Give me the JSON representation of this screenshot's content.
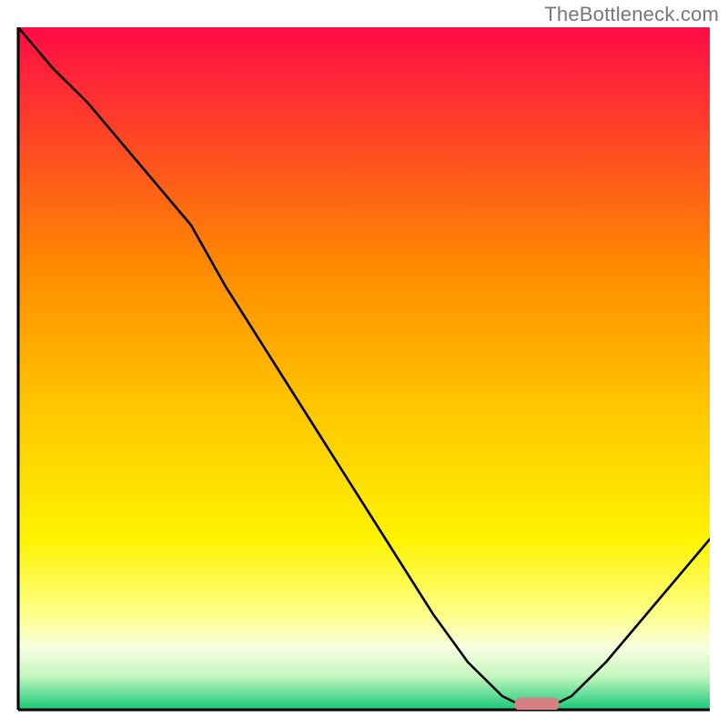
{
  "watermark": "TheBottleneck.com",
  "chart_data": {
    "type": "line",
    "title": "",
    "xlabel": "",
    "ylabel": "",
    "xlim": [
      0,
      100
    ],
    "ylim": [
      0,
      100
    ],
    "background_gradient": {
      "top": "#ff0b46",
      "upper_mid": "#ffa300",
      "lower_mid": "#fef300",
      "band": "#f5ffe2",
      "bottom": "#16c978"
    },
    "series": [
      {
        "name": "bottleneck-curve",
        "color": "#000000",
        "x": [
          0,
          5,
          10,
          15,
          20,
          25,
          30,
          35,
          40,
          45,
          50,
          55,
          60,
          65,
          70,
          72,
          75,
          78,
          80,
          85,
          90,
          95,
          100
        ],
        "y": [
          100,
          94,
          89,
          83,
          77,
          71,
          62,
          54,
          46,
          38,
          30,
          22,
          14,
          7,
          2,
          1,
          1,
          1,
          2,
          7,
          13,
          19,
          25
        ]
      }
    ],
    "markers": [
      {
        "name": "recommended-marker",
        "shape": "rounded-bar",
        "color": "#d68083",
        "x_center": 75,
        "y_center": 0.8,
        "width_pct": 6.5,
        "height_pct": 2.0
      }
    ]
  }
}
